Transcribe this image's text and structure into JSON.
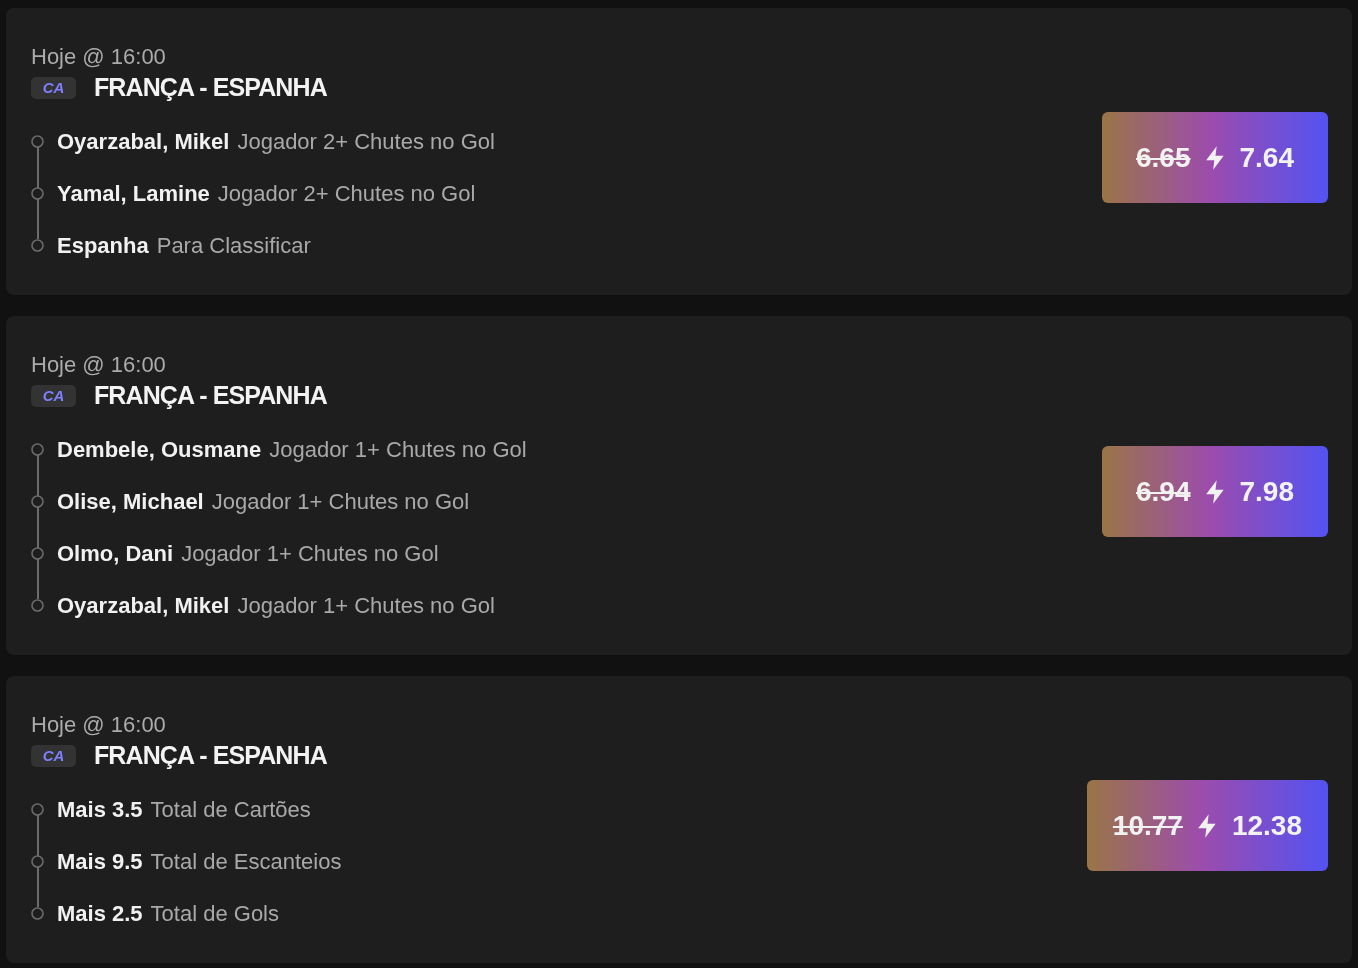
{
  "bets": [
    {
      "time": "Hoje @ 16:00",
      "competition": "CA",
      "match": "FRANÇA - ESPANHA",
      "selections": [
        {
          "name": "Oyarzabal, Mikel",
          "market": "Jogador 2+ Chutes no Gol"
        },
        {
          "name": "Yamal, Lamine",
          "market": "Jogador 2+ Chutes no Gol"
        },
        {
          "name": "Espanha",
          "market": "Para Classificar"
        }
      ],
      "odds": {
        "original": "6.65",
        "boosted": "7.64"
      }
    },
    {
      "time": "Hoje @ 16:00",
      "competition": "CA",
      "match": "FRANÇA - ESPANHA",
      "selections": [
        {
          "name": "Dembele, Ousmane",
          "market": "Jogador 1+ Chutes no Gol"
        },
        {
          "name": "Olise, Michael",
          "market": "Jogador 1+ Chutes no Gol"
        },
        {
          "name": "Olmo, Dani",
          "market": "Jogador 1+ Chutes no Gol"
        },
        {
          "name": "Oyarzabal, Mikel",
          "market": "Jogador 1+ Chutes no Gol"
        }
      ],
      "odds": {
        "original": "6.94",
        "boosted": "7.98"
      }
    },
    {
      "time": "Hoje @ 16:00",
      "competition": "CA",
      "match": "FRANÇA - ESPANHA",
      "selections": [
        {
          "name": "Mais 3.5",
          "market": "Total de Cartões"
        },
        {
          "name": "Mais 9.5",
          "market": "Total de Escanteios"
        },
        {
          "name": "Mais 2.5",
          "market": "Total de Gols"
        }
      ],
      "odds": {
        "original": "10.77",
        "boosted": "12.38"
      }
    }
  ]
}
